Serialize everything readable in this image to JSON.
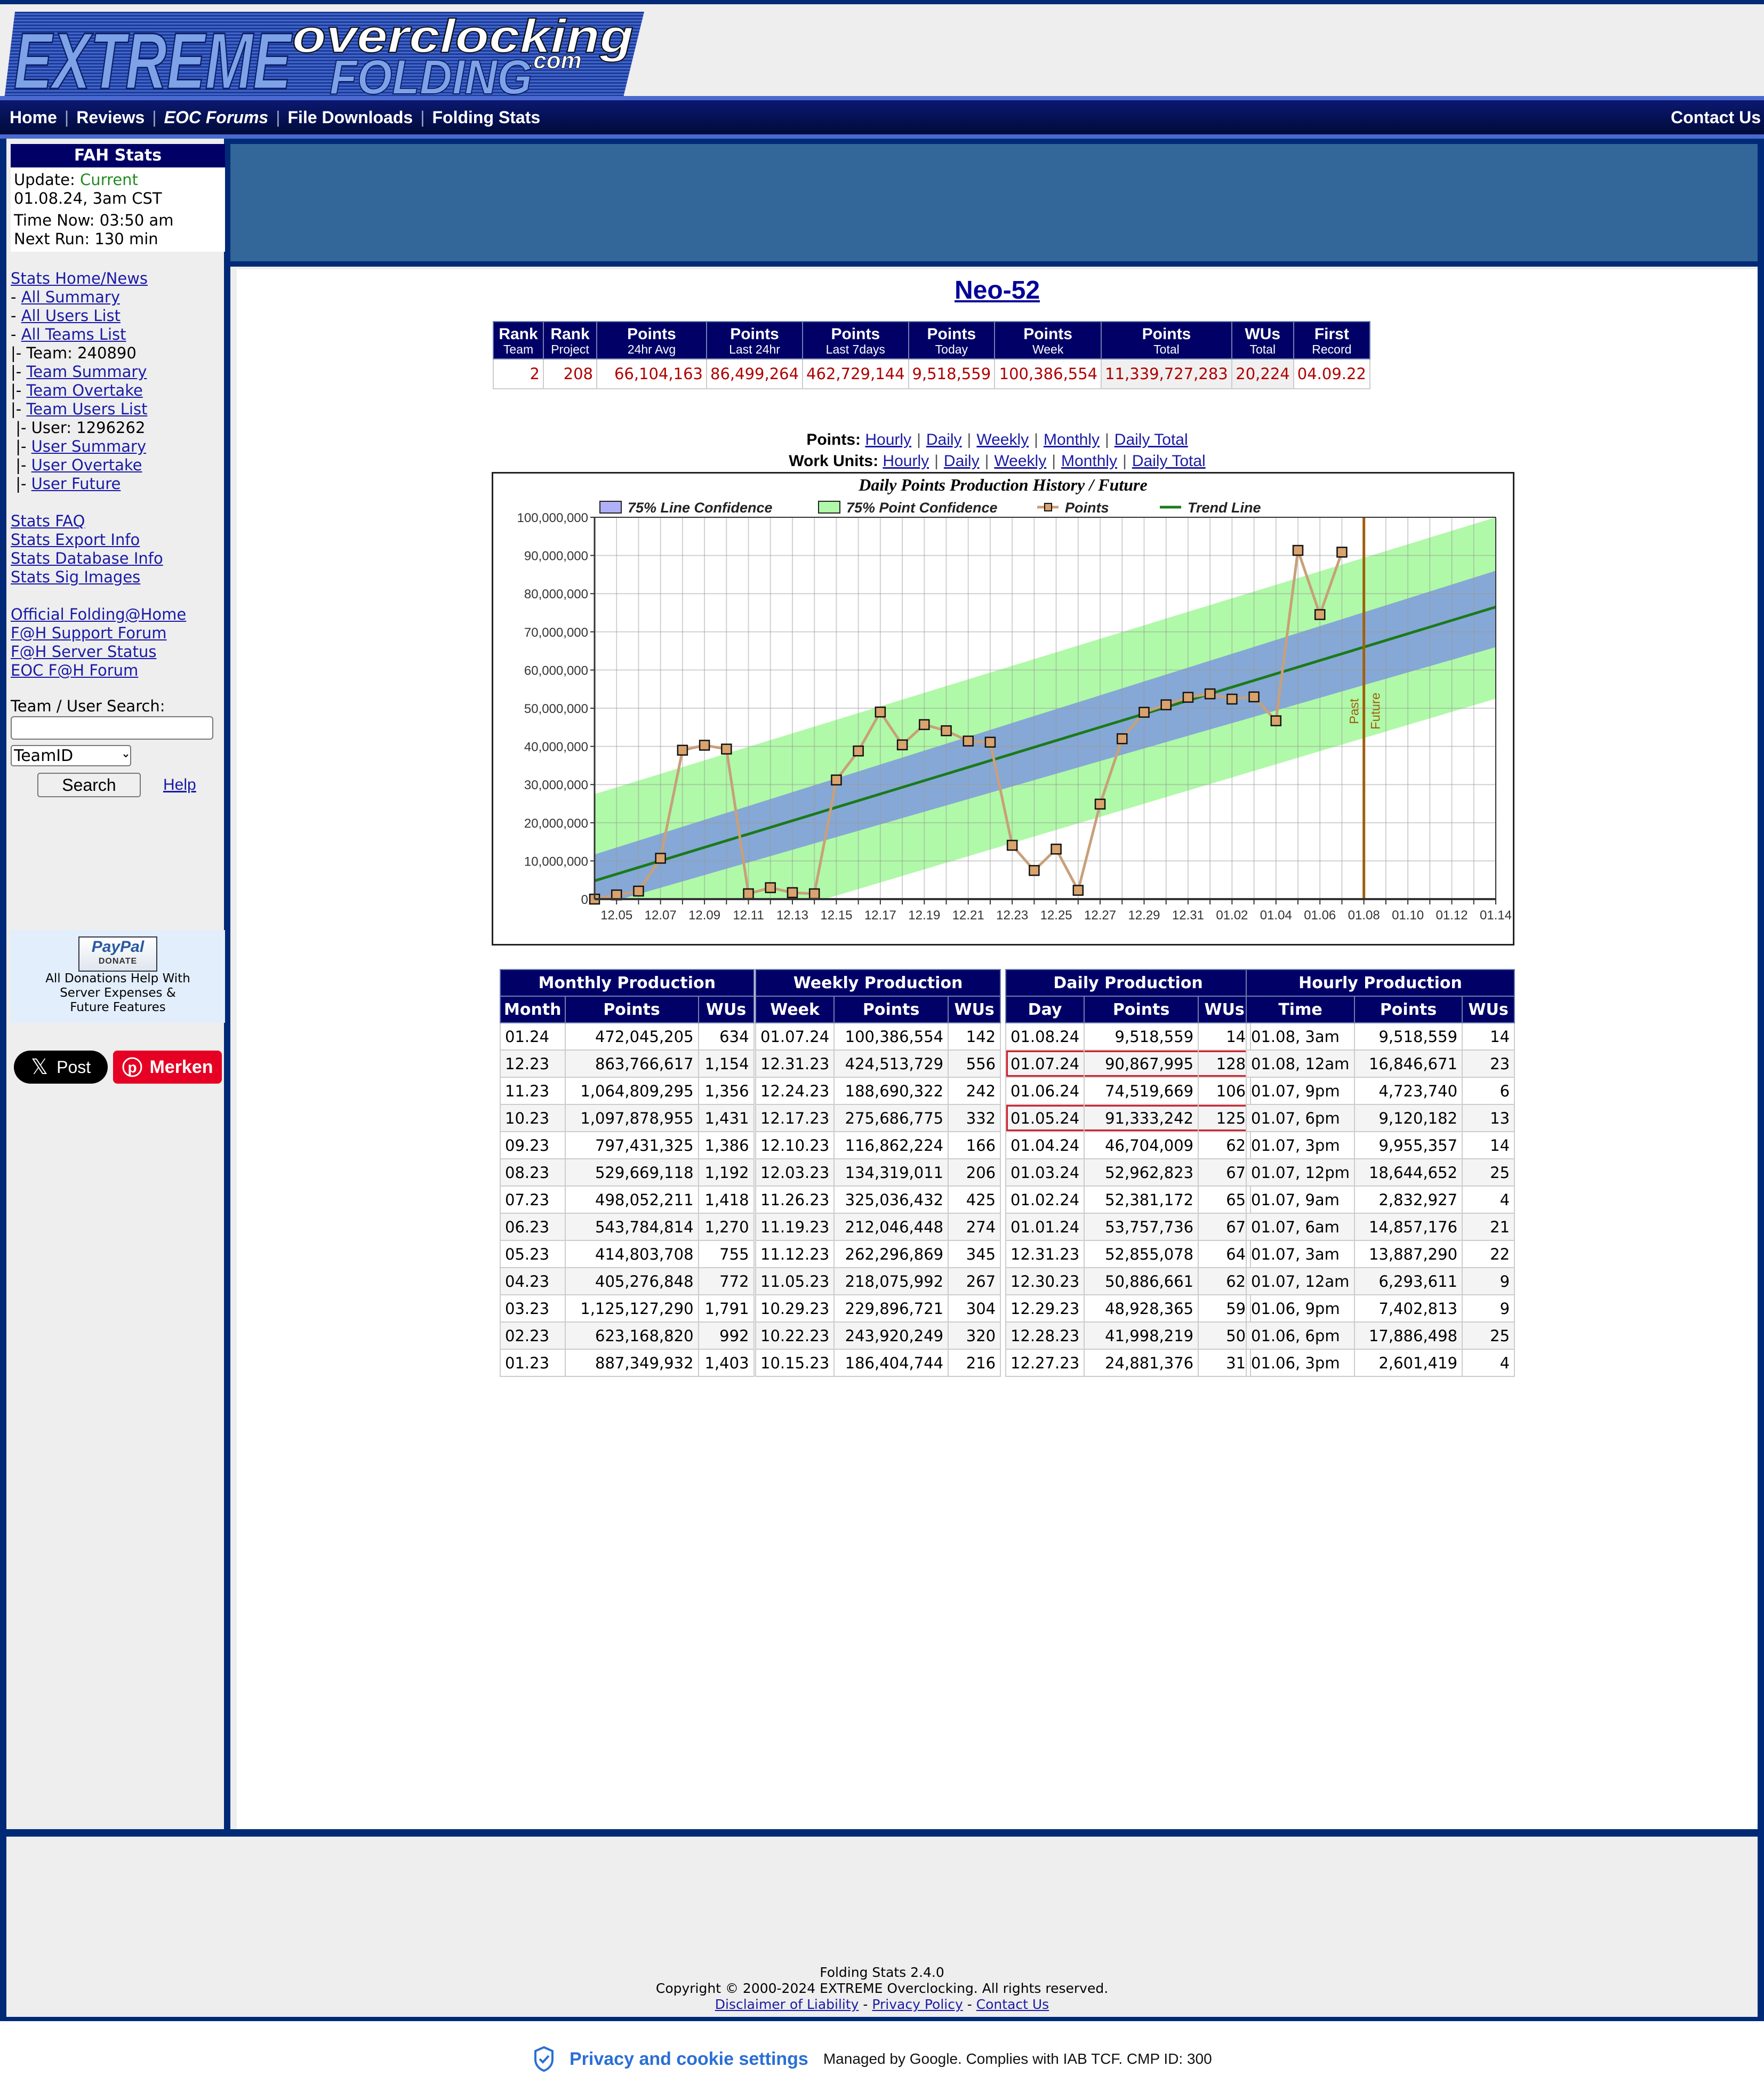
{
  "header": {
    "logo_text_main": "EXTREME",
    "logo_text_over": "overclocking",
    "logo_text_com": ".com",
    "logo_text_folding": "FOLDING",
    "nav": [
      "Home",
      "Reviews",
      "EOC Forums",
      "File Downloads",
      "Folding Stats"
    ],
    "contact": "Contact Us"
  },
  "sidebar": {
    "fah_title": "FAH Stats",
    "update_label": "Update:",
    "update_status": "Current",
    "update_time": "01.08.24, 3am CST",
    "time_now": "Time Now: 03:50 am",
    "next_run": "Next Run: 130 min",
    "links": {
      "stats_home": "Stats Home/News",
      "all_summary": "All Summary",
      "all_users": "All Users List",
      "all_teams": "All Teams List",
      "team_label": "Team: 240890",
      "team_summary": "Team Summary",
      "team_overtake": "Team Overtake",
      "team_users": "Team Users List",
      "user_label": "User: 1296262",
      "user_summary": "User Summary",
      "user_overtake": "User Overtake",
      "user_future": "User Future",
      "faq": "Stats FAQ",
      "export": "Stats Export Info",
      "database": "Stats Database Info",
      "sig": "Stats Sig Images",
      "official": "Official Folding@Home",
      "support": "F@H Support Forum",
      "server": "F@H Server Status",
      "eoc_forum": "EOC F@H Forum"
    },
    "search": {
      "label": "Team / User Search:",
      "input_value": "",
      "select_value": "TeamID",
      "button": "Search",
      "help": "Help"
    },
    "donate": {
      "paypal": "PayPal",
      "donate": "DONATE",
      "text1": "All Donations Help With",
      "text2": "Server Expenses &",
      "text3": "Future Features"
    },
    "social": {
      "x_post": "Post",
      "pinterest": "Merken"
    }
  },
  "main": {
    "title": "Neo-52",
    "summary": {
      "headers": [
        {
          "top": "Rank",
          "sub": "Team"
        },
        {
          "top": "Rank",
          "sub": "Project"
        },
        {
          "top": "Points",
          "sub": "24hr Avg"
        },
        {
          "top": "Points",
          "sub": "Last 24hr"
        },
        {
          "top": "Points",
          "sub": "Last 7days"
        },
        {
          "top": "Points",
          "sub": "Today"
        },
        {
          "top": "Points",
          "sub": "Week"
        },
        {
          "top": "Points",
          "sub": "Total"
        },
        {
          "top": "WUs",
          "sub": "Total"
        },
        {
          "top": "First",
          "sub": "Record"
        }
      ],
      "values": [
        "2",
        "208",
        "66,104,163",
        "86,499,264",
        "462,729,144",
        "9,518,559",
        "100,386,554",
        "11,339,727,283",
        "20,224",
        "04.09.22"
      ]
    },
    "chart_links": {
      "points_label": "Points:",
      "wu_label": "Work Units:",
      "items": [
        "Hourly",
        "Daily",
        "Weekly",
        "Monthly",
        "Daily Total"
      ]
    }
  },
  "chart_data": {
    "type": "line",
    "title": "Daily Points Production History / Future",
    "legend": [
      "75% Line Confidence",
      "75% Point Confidence",
      "Points",
      "Trend Line"
    ],
    "legend_position": "top",
    "xlabel": "",
    "ylabel": "",
    "ylim": [
      0,
      100000000
    ],
    "yticks": [
      "0",
      "10,000,000",
      "20,000,000",
      "30,000,000",
      "40,000,000",
      "50,000,000",
      "60,000,000",
      "70,000,000",
      "80,000,000",
      "90,000,000",
      "100,000,000"
    ],
    "xticks": [
      "12.05",
      "12.07",
      "12.09",
      "12.11",
      "12.13",
      "12.15",
      "12.17",
      "12.19",
      "12.21",
      "12.23",
      "12.25",
      "12.27",
      "12.29",
      "12.31",
      "01.02",
      "01.04",
      "01.06",
      "01.08",
      "01.10",
      "01.12",
      "01.14"
    ],
    "x_days_range": [
      0,
      41
    ],
    "divider_day": 35,
    "divider_labels": [
      "Past",
      "Future"
    ],
    "points_series": {
      "name": "Points",
      "x_dates": [
        "12.04",
        "12.05",
        "12.06",
        "12.07",
        "12.08",
        "12.09",
        "12.10",
        "12.11",
        "12.12",
        "12.13",
        "12.14",
        "12.15",
        "12.16",
        "12.17",
        "12.18",
        "12.19",
        "12.20",
        "12.21",
        "12.22",
        "12.23",
        "12.24",
        "12.25",
        "12.26",
        "12.27",
        "12.28",
        "12.29",
        "12.30",
        "12.31",
        "01.01",
        "01.02",
        "01.03",
        "01.04",
        "01.05",
        "01.06",
        "01.07"
      ],
      "values": [
        0,
        1100000,
        2100000,
        10700000,
        39000000,
        40300000,
        39300000,
        1400000,
        3000000,
        1700000,
        1400000,
        31200000,
        38800000,
        49000000,
        40400000,
        45700000,
        44100000,
        41400000,
        41100000,
        14100000,
        7500000,
        13100000,
        2300000,
        24881376,
        41998219,
        48928365,
        50886661,
        52855078,
        53757736,
        52381172,
        52962823,
        46704009,
        91333242,
        74519669,
        90867995
      ]
    },
    "trend_line": {
      "start": 4800000,
      "end": 76500000
    },
    "line_confidence": {
      "start": [
        -2000000,
        11700000
      ],
      "end": [
        66000000,
        86000000
      ]
    },
    "point_confidence": {
      "start": [
        -18000000,
        27500000
      ],
      "end": [
        52500000,
        100000000
      ]
    }
  },
  "production": {
    "monthly": {
      "title": "Monthly Production",
      "headers": [
        "Month",
        "Points",
        "WUs"
      ],
      "rows": [
        [
          "01.24",
          "472,045,205",
          "634"
        ],
        [
          "12.23",
          "863,766,617",
          "1,154"
        ],
        [
          "11.23",
          "1,064,809,295",
          "1,356"
        ],
        [
          "10.23",
          "1,097,878,955",
          "1,431"
        ],
        [
          "09.23",
          "797,431,325",
          "1,386"
        ],
        [
          "08.23",
          "529,669,118",
          "1,192"
        ],
        [
          "07.23",
          "498,052,211",
          "1,418"
        ],
        [
          "06.23",
          "543,784,814",
          "1,270"
        ],
        [
          "05.23",
          "414,803,708",
          "755"
        ],
        [
          "04.23",
          "405,276,848",
          "772"
        ],
        [
          "03.23",
          "1,125,127,290",
          "1,791"
        ],
        [
          "02.23",
          "623,168,820",
          "992"
        ],
        [
          "01.23",
          "887,349,932",
          "1,403"
        ]
      ]
    },
    "weekly": {
      "title": "Weekly Production",
      "headers": [
        "Week",
        "Points",
        "WUs"
      ],
      "rows": [
        [
          "01.07.24",
          "100,386,554",
          "142"
        ],
        [
          "12.31.23",
          "424,513,729",
          "556"
        ],
        [
          "12.24.23",
          "188,690,322",
          "242"
        ],
        [
          "12.17.23",
          "275,686,775",
          "332"
        ],
        [
          "12.10.23",
          "116,862,224",
          "166"
        ],
        [
          "12.03.23",
          "134,319,011",
          "206"
        ],
        [
          "11.26.23",
          "325,036,432",
          "425"
        ],
        [
          "11.19.23",
          "212,046,448",
          "274"
        ],
        [
          "11.12.23",
          "262,296,869",
          "345"
        ],
        [
          "11.05.23",
          "218,075,992",
          "267"
        ],
        [
          "10.29.23",
          "229,896,721",
          "304"
        ],
        [
          "10.22.23",
          "243,920,249",
          "320"
        ],
        [
          "10.15.23",
          "186,404,744",
          "216"
        ]
      ]
    },
    "daily": {
      "title": "Daily Production",
      "headers": [
        "Day",
        "Points",
        "WUs"
      ],
      "highlighted_rows": [
        1,
        3
      ],
      "rows": [
        [
          "01.08.24",
          "9,518,559",
          "14"
        ],
        [
          "01.07.24",
          "90,867,995",
          "128"
        ],
        [
          "01.06.24",
          "74,519,669",
          "106"
        ],
        [
          "01.05.24",
          "91,333,242",
          "125"
        ],
        [
          "01.04.24",
          "46,704,009",
          "62"
        ],
        [
          "01.03.24",
          "52,962,823",
          "67"
        ],
        [
          "01.02.24",
          "52,381,172",
          "65"
        ],
        [
          "01.01.24",
          "53,757,736",
          "67"
        ],
        [
          "12.31.23",
          "52,855,078",
          "64"
        ],
        [
          "12.30.23",
          "50,886,661",
          "62"
        ],
        [
          "12.29.23",
          "48,928,365",
          "59"
        ],
        [
          "12.28.23",
          "41,998,219",
          "50"
        ],
        [
          "12.27.23",
          "24,881,376",
          "31"
        ]
      ]
    },
    "hourly": {
      "title": "Hourly Production",
      "headers": [
        "Time",
        "Points",
        "WUs"
      ],
      "rows": [
        [
          "01.08, 3am",
          "9,518,559",
          "14"
        ],
        [
          "01.08, 12am",
          "16,846,671",
          "23"
        ],
        [
          "01.07, 9pm",
          "4,723,740",
          "6"
        ],
        [
          "01.07, 6pm",
          "9,120,182",
          "13"
        ],
        [
          "01.07, 3pm",
          "9,955,357",
          "14"
        ],
        [
          "01.07, 12pm",
          "18,644,652",
          "25"
        ],
        [
          "01.07, 9am",
          "2,832,927",
          "4"
        ],
        [
          "01.07, 6am",
          "14,857,176",
          "21"
        ],
        [
          "01.07, 3am",
          "13,887,290",
          "22"
        ],
        [
          "01.07, 12am",
          "6,293,611",
          "9"
        ],
        [
          "01.06, 9pm",
          "7,402,813",
          "9"
        ],
        [
          "01.06, 6pm",
          "17,886,498",
          "25"
        ],
        [
          "01.06, 3pm",
          "2,601,419",
          "4"
        ]
      ]
    }
  },
  "footer": {
    "version": "Folding Stats 2.4.0",
    "copyright": "Copyright © 2000-2024 EXTREME Overclocking. All rights reserved.",
    "disclaimer": "Disclaimer of Liability",
    "privacy": "Privacy Policy",
    "contact": "Contact Us"
  },
  "consent": {
    "link": "Privacy and cookie settings",
    "info": "Managed by Google. Complies with IAB TCF. CMP ID: 300"
  },
  "colors": {
    "navy": "#000066",
    "frame": "#002a77",
    "banner": "#336699",
    "value_red": "#b00000",
    "points_line": "#c8a07a",
    "trend_green": "#1a7a1a",
    "line_conf": "#86a8d6",
    "point_conf": "#b0f9a8",
    "divider": "#a0600a",
    "highlight_red": "#d41e2a"
  }
}
